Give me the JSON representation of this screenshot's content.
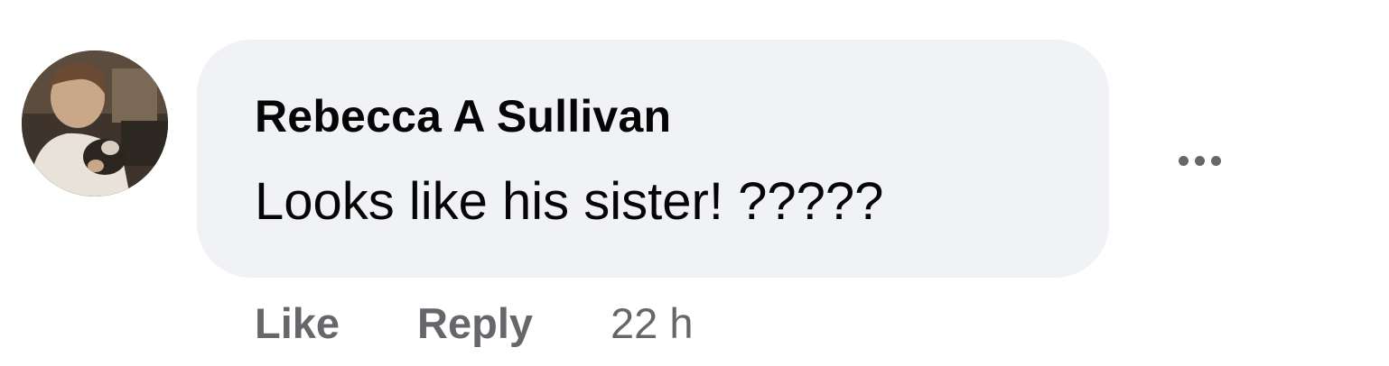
{
  "comment": {
    "author": "Rebecca A Sullivan",
    "text": "Looks like his sister! ?????",
    "actions": {
      "like_label": "Like",
      "reply_label": "Reply",
      "timestamp": "22 h"
    },
    "more_icon": "more-horizontal-icon",
    "avatar_icon": "profile-photo"
  },
  "colors": {
    "bubble_background": "#f0f2f5",
    "primary_text": "#050505",
    "secondary_text": "#65676b"
  }
}
